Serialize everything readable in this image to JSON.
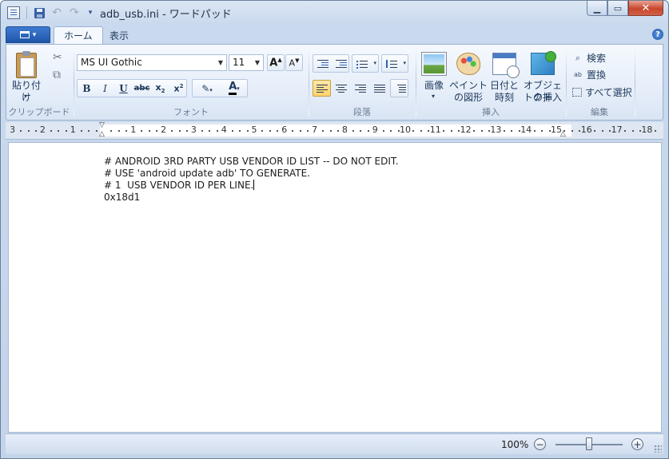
{
  "window": {
    "title": "adb_usb.ini - ワードパッド",
    "colors": {
      "accent": "#1e55a8",
      "close": "#c8462c",
      "selected_btn": "#ffd36b"
    }
  },
  "tabs": [
    {
      "label": "ホーム",
      "active": true
    },
    {
      "label": "表示",
      "active": false
    }
  ],
  "ribbon": {
    "clipboard": {
      "paste_label": "貼り付け",
      "group_label": "クリップボード"
    },
    "font": {
      "font_name": "MS UI Gothic",
      "font_size": "11",
      "group_label": "フォント"
    },
    "paragraph": {
      "group_label": "段落"
    },
    "insert": {
      "picture_label": "画像",
      "paint_label_1": "ペイント",
      "paint_label_2": "の図形",
      "datetime_label_1": "日付と",
      "datetime_label_2": "時刻",
      "object_label_1": "オブジェクト",
      "object_label_2": "トの挿入",
      "group_label": "挿入"
    },
    "editing": {
      "find_label": "検索",
      "replace_label": "置換",
      "select_all_label": "すべて選択",
      "group_label": "編集"
    }
  },
  "ruler": {
    "numbers": [
      "3",
      "2",
      "1",
      "1",
      "2",
      "3",
      "4",
      "5",
      "6",
      "7",
      "8",
      "9",
      "10",
      "11",
      "12",
      "13",
      "14",
      "15",
      "16",
      "17",
      "18"
    ]
  },
  "document": {
    "lines": [
      "# ANDROID 3RD PARTY USB VENDOR ID LIST -- DO NOT EDIT.",
      "# USE 'android update adb' TO GENERATE.",
      "# 1  USB VENDOR ID PER LINE.",
      "0x18d1"
    ]
  },
  "statusbar": {
    "zoom": "100%",
    "zoom_level_percent": 100
  }
}
